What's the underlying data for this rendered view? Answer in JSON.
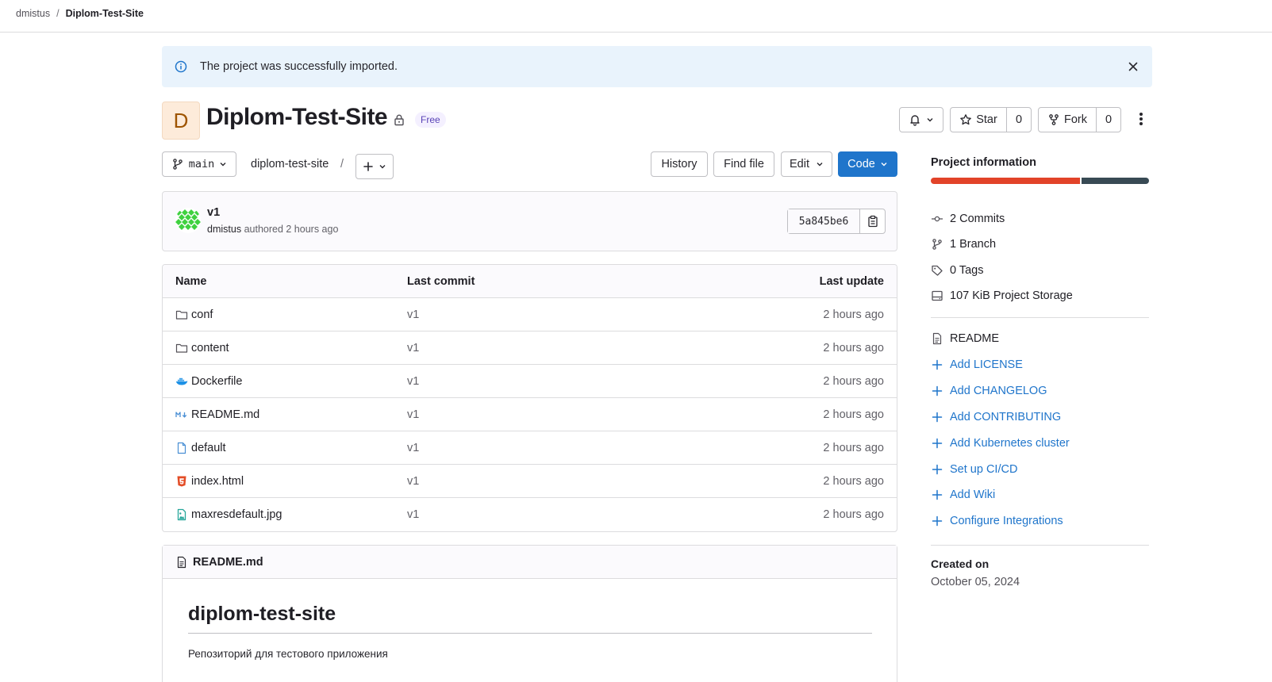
{
  "breadcrumb": {
    "owner": "dmistus",
    "separator": "/",
    "project": "Diplom-Test-Site"
  },
  "alert": {
    "message": "The project was successfully imported."
  },
  "project": {
    "avatar_letter": "D",
    "title": "Diplom-Test-Site",
    "badge": "Free",
    "star_label": "Star",
    "star_count": "0",
    "fork_label": "Fork",
    "fork_count": "0"
  },
  "toolbar": {
    "branch": "main",
    "path": "diplom-test-site",
    "path_separator": "/",
    "history": "History",
    "find_file": "Find file",
    "edit": "Edit",
    "code": "Code"
  },
  "commit": {
    "title": "v1",
    "author": "dmistus",
    "meta": "authored 2 hours ago",
    "sha": "5a845be6"
  },
  "tree": {
    "headers": {
      "name": "Name",
      "last_commit": "Last commit",
      "last_update": "Last update"
    },
    "rows": [
      {
        "name": "conf",
        "icon": "folder-icon",
        "commit": "v1",
        "update": "2 hours ago"
      },
      {
        "name": "content",
        "icon": "folder-icon",
        "commit": "v1",
        "update": "2 hours ago"
      },
      {
        "name": "Dockerfile",
        "icon": "docker-icon",
        "commit": "v1",
        "update": "2 hours ago"
      },
      {
        "name": "README.md",
        "icon": "markdown-icon",
        "commit": "v1",
        "update": "2 hours ago"
      },
      {
        "name": "default",
        "icon": "file-icon",
        "commit": "v1",
        "update": "2 hours ago"
      },
      {
        "name": "index.html",
        "icon": "html5-icon",
        "commit": "v1",
        "update": "2 hours ago"
      },
      {
        "name": "maxresdefault.jpg",
        "icon": "image-icon",
        "commit": "v1",
        "update": "2 hours ago"
      }
    ]
  },
  "readme": {
    "filename": "README.md",
    "heading": "diplom-test-site",
    "text": "Репозиторий для тестового приложения"
  },
  "sidebar": {
    "title": "Project information",
    "languages": [
      {
        "color": "#e24329",
        "share": 0.69
      },
      {
        "color": "#384a54",
        "share": 0.31
      }
    ],
    "stats": {
      "commits": "2 Commits",
      "branches": "1 Branch",
      "tags": "0 Tags",
      "storage": "107 KiB Project Storage"
    },
    "readme": "README",
    "links": {
      "license": "Add LICENSE",
      "changelog": "Add CHANGELOG",
      "contributing": "Add CONTRIBUTING",
      "kubernetes": "Add Kubernetes cluster",
      "cicd": "Set up CI/CD",
      "wiki": "Add Wiki",
      "integrations": "Configure Integrations"
    },
    "created_label": "Created on",
    "created_date": "October 05, 2024"
  },
  "colors": {
    "accent": "#1f75cb",
    "alert_bg": "#e9f3fc",
    "badge_text": "#5943b6"
  }
}
